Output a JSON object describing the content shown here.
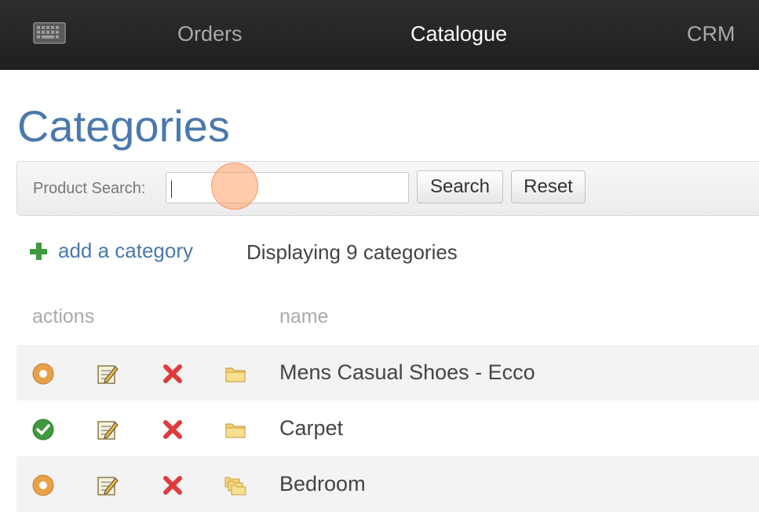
{
  "nav": {
    "logo_icon": "keyboard-icon",
    "items": [
      {
        "label": "Orders",
        "active": false
      },
      {
        "label": "Catalogue",
        "active": true
      },
      {
        "label": "CRM",
        "active": false
      }
    ]
  },
  "page": {
    "title": "Categories"
  },
  "search": {
    "label": "Product Search:",
    "value": "",
    "search_label": "Search",
    "reset_label": "Reset"
  },
  "toolbar": {
    "add_label": "add a category",
    "add_icon": "plus-icon",
    "count_text": "Displaying 9 categories"
  },
  "table": {
    "columns": [
      "actions",
      "name"
    ],
    "rows": [
      {
        "name": "Mens Casual Shoes - Ecco",
        "status": "inactive",
        "status_icon": "orange-circle-icon",
        "folder_icon": "folder-icon"
      },
      {
        "name": "Carpet",
        "status": "active",
        "status_icon": "green-check-icon",
        "folder_icon": "folder-icon"
      },
      {
        "name": "Bedroom",
        "status": "inactive",
        "status_icon": "orange-circle-icon",
        "folder_icon": "folders-icon"
      }
    ]
  },
  "colors": {
    "accent": "#4a79ad",
    "navbar": "#262626",
    "active_green": "#3f9a3f",
    "inactive_orange": "#e8a04a",
    "delete_red": "#e03b3b"
  }
}
